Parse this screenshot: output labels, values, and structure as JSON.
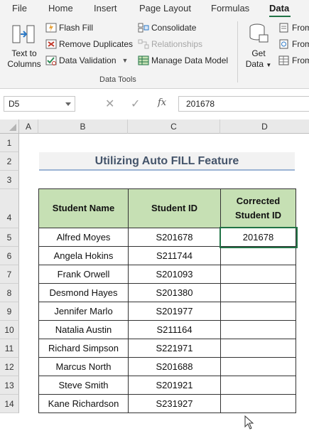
{
  "ribbon": {
    "tabs": [
      "File",
      "Home",
      "Insert",
      "Page Layout",
      "Formulas",
      "Data"
    ],
    "active_tab": "Data",
    "text_to_columns": [
      "Text to",
      "Columns"
    ],
    "flash_fill": "Flash Fill",
    "remove_duplicates": "Remove Duplicates",
    "data_validation": "Data Validation",
    "consolidate": "Consolidate",
    "relationships": "Relationships",
    "manage_data_model": "Manage Data Model",
    "group_label": "Data Tools",
    "get_data": [
      "Get",
      "Data"
    ],
    "from_items": [
      "From",
      "From",
      "From"
    ]
  },
  "formula_bar": {
    "name_box": "D5",
    "fx_label": "fx",
    "value": "201678"
  },
  "columns": [
    "A",
    "B",
    "C",
    "D"
  ],
  "rows": [
    "1",
    "2",
    "3",
    "4",
    "5",
    "6",
    "7",
    "8",
    "9",
    "10",
    "11",
    "12",
    "13",
    "14"
  ],
  "sheet": {
    "title": "Utilizing Auto FILL Feature",
    "headers": [
      "Student Name",
      "Student ID",
      "Corrected\nStudent ID"
    ],
    "data": [
      [
        "Alfred Moyes",
        "S201678",
        "201678"
      ],
      [
        "Angela Hokins",
        "S211744",
        ""
      ],
      [
        "Frank Orwell",
        "S201093",
        ""
      ],
      [
        "Desmond Hayes",
        "S201380",
        ""
      ],
      [
        "Jennifer Marlo",
        "S201977",
        ""
      ],
      [
        "Natalia Austin",
        "S211164",
        ""
      ],
      [
        "Richard Simpson",
        "S221971",
        ""
      ],
      [
        "Marcus North",
        "S201688",
        ""
      ],
      [
        "Steve Smith",
        "S201921",
        ""
      ],
      [
        "Kane Richardson",
        "S231927",
        ""
      ]
    ]
  },
  "colors": {
    "accent": "#217346",
    "header_fill": "#c6e0b4",
    "title_text": "#44546a",
    "title_underline": "#9bb3d4"
  }
}
